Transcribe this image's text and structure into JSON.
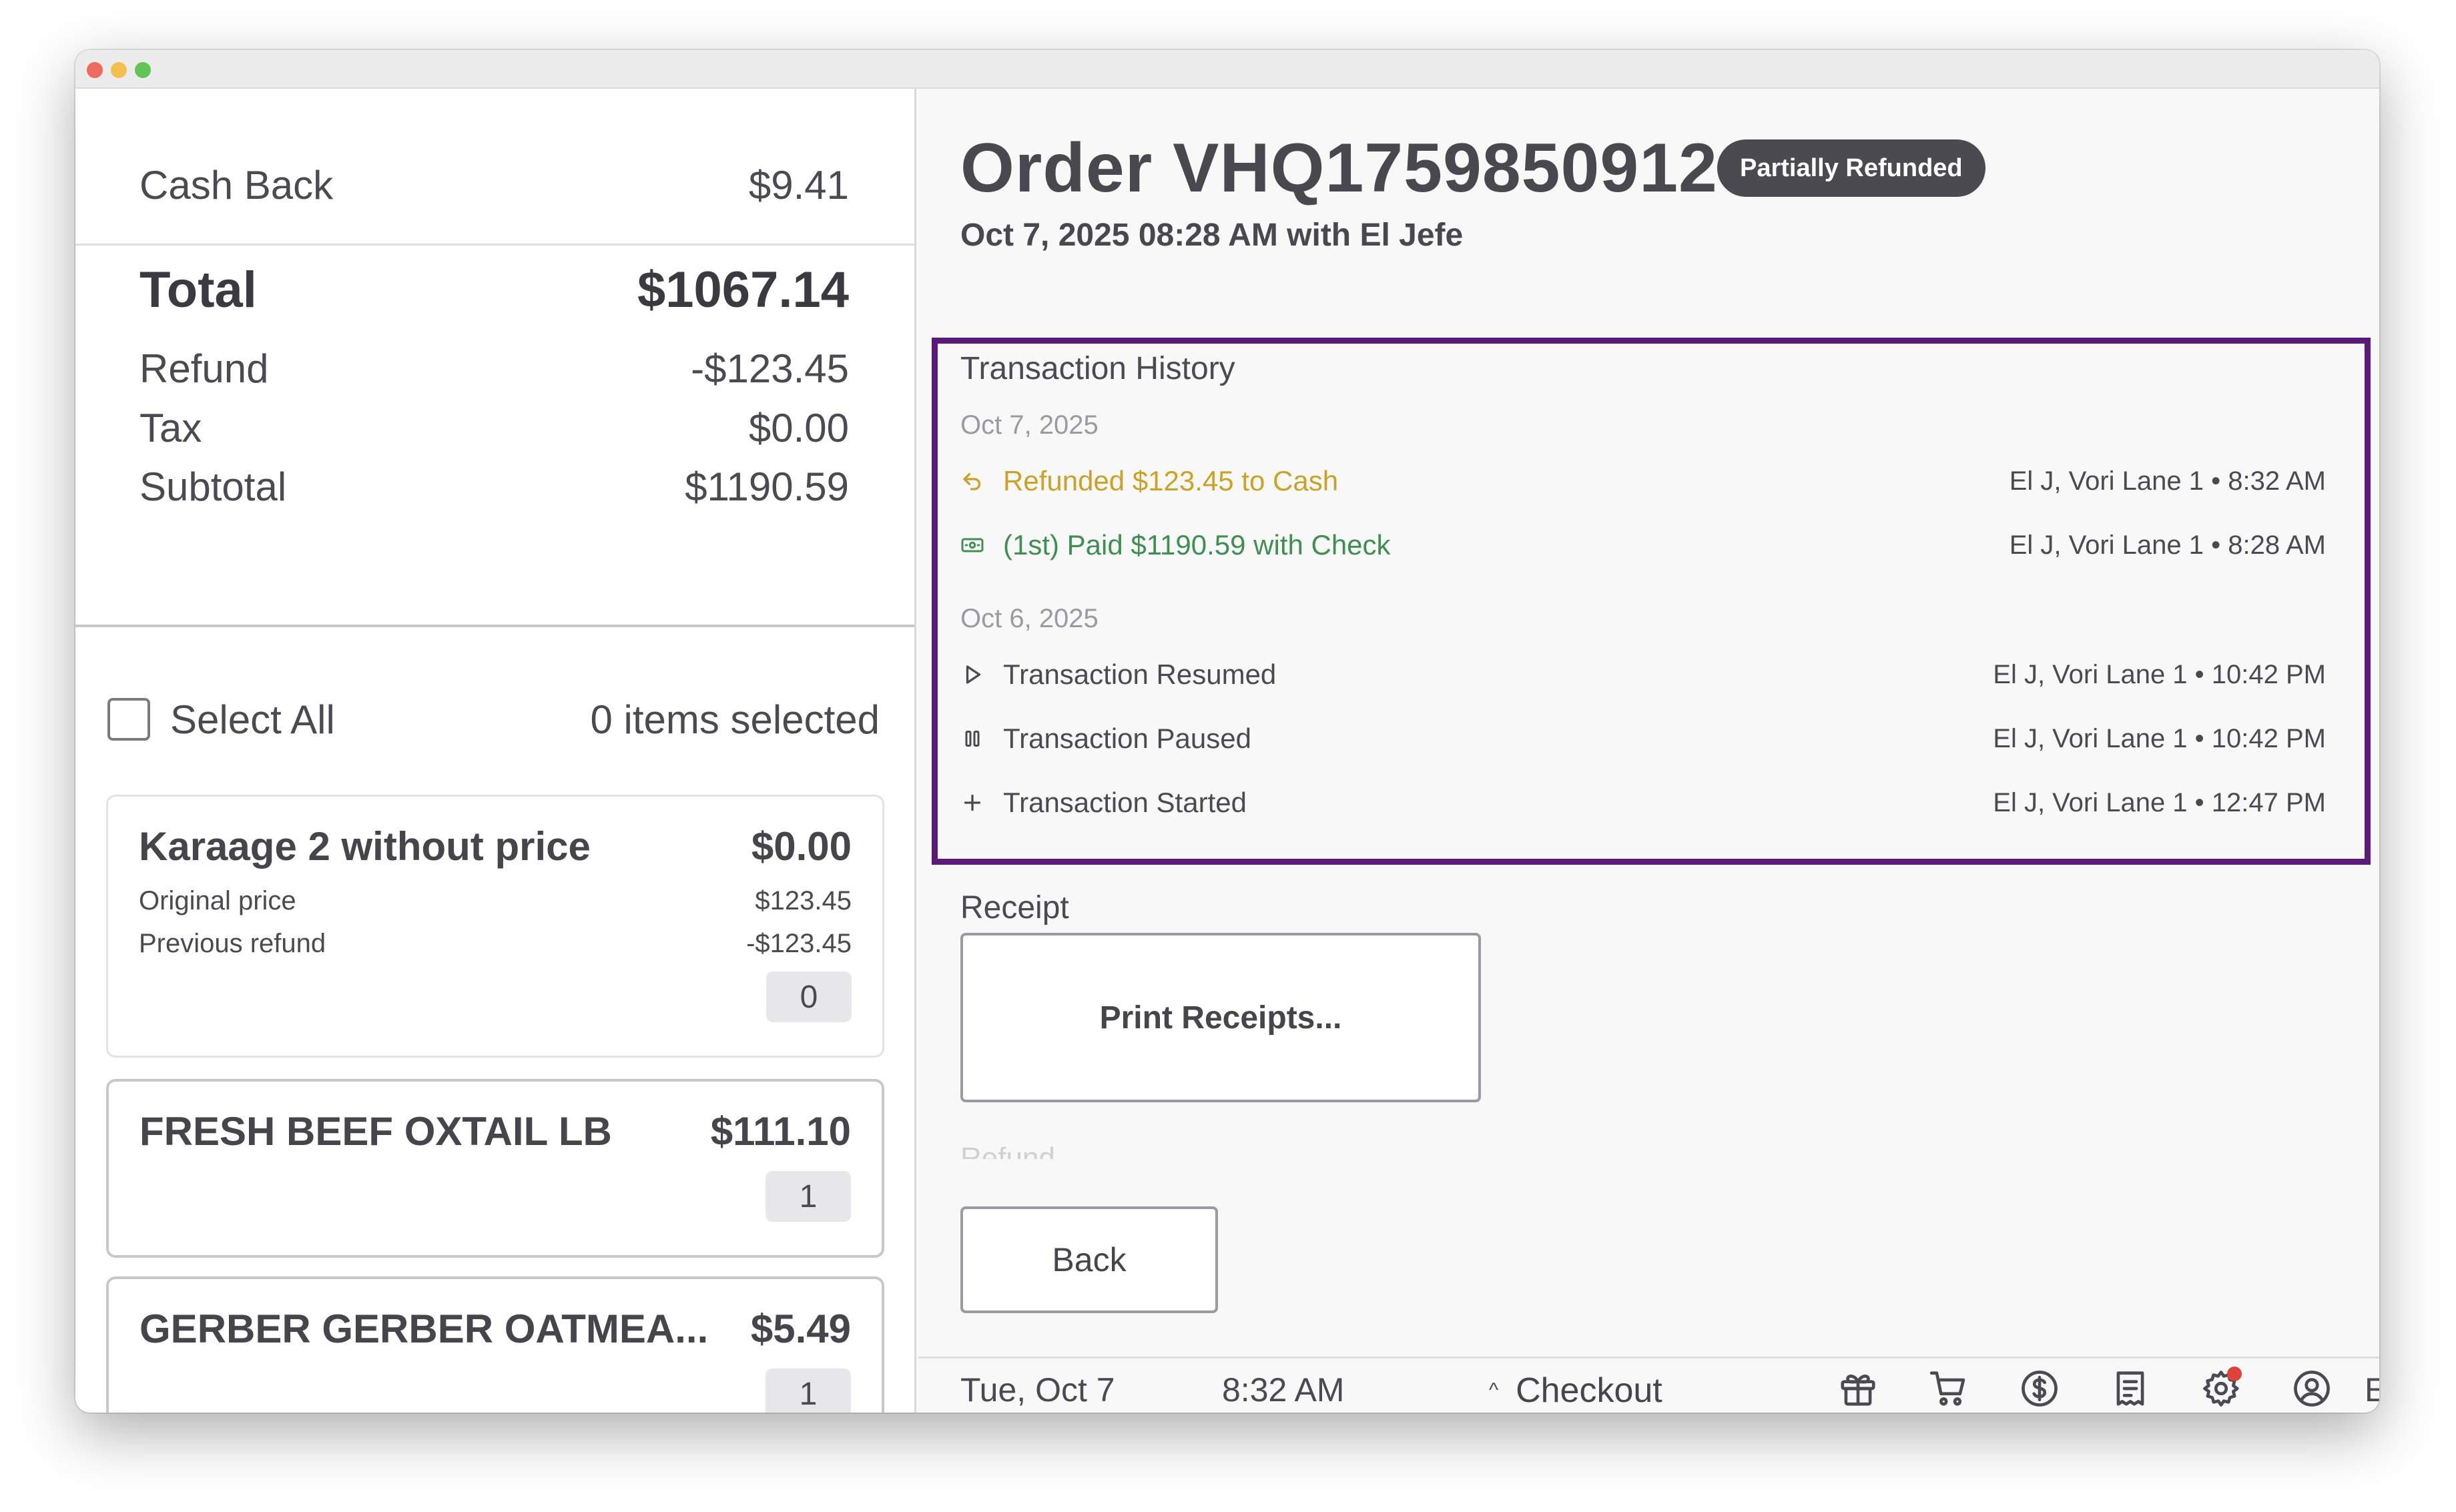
{
  "summary": {
    "cash_back_label": "Cash Back",
    "cash_back_value": "$9.41",
    "total_label": "Total",
    "total_value": "$1067.14",
    "refund_label": "Refund",
    "refund_value": "-$123.45",
    "tax_label": "Tax",
    "tax_value": "$0.00",
    "subtotal_label": "Subtotal",
    "subtotal_value": "$1190.59"
  },
  "selection": {
    "select_all_label": "Select All",
    "selected_count": "0 items selected"
  },
  "items": [
    {
      "name": "Karaage 2 without price",
      "price": "$0.00",
      "original_label": "Original price",
      "original_value": "$123.45",
      "prev_refund_label": "Previous refund",
      "prev_refund_value": "-$123.45",
      "qty": "0"
    },
    {
      "name": "FRESH BEEF OXTAIL LB",
      "price": "$111.10",
      "qty": "1"
    },
    {
      "name": "GERBER GERBER OATMEA...",
      "price": "$5.49",
      "qty": "1"
    }
  ],
  "order": {
    "title": "Order VHQ1759850912",
    "status_badge": "Partially Refunded",
    "subtitle": "Oct 7, 2025 08:28 AM with El Jefe"
  },
  "history": {
    "title": "Transaction History",
    "groups": [
      {
        "date": "Oct 7, 2025",
        "entries": [
          {
            "label": "Refunded $123.45 to Cash",
            "meta": "El J, Vori Lane 1 • 8:32 AM",
            "icon": "refund-arrow-icon",
            "color": "#c9a227"
          },
          {
            "label": "(1st) Paid $1190.59 with Check",
            "meta": "El J, Vori Lane 1 • 8:28 AM",
            "icon": "cash-icon",
            "color": "#3f8f52"
          }
        ]
      },
      {
        "date": "Oct 6, 2025",
        "entries": [
          {
            "label": "Transaction Resumed",
            "meta": "El J, Vori Lane 1 • 10:42 PM",
            "icon": "play-icon"
          },
          {
            "label": "Transaction Paused",
            "meta": "El J, Vori Lane 1 • 10:42 PM",
            "icon": "pause-icon"
          },
          {
            "label": "Transaction Started",
            "meta": "El J, Vori Lane 1 • 12:47 PM",
            "icon": "plus-icon"
          }
        ]
      }
    ]
  },
  "receipt": {
    "title": "Receipt",
    "print_label": "Print Receipts..."
  },
  "refund_section": {
    "title": "Refund"
  },
  "actions": {
    "back_label": "Back"
  },
  "footer": {
    "date": "Tue, Oct 7",
    "time": "8:32 AM",
    "checkout_label": "Checkout",
    "icons": [
      "gift-icon",
      "cart-icon",
      "dollar-icon",
      "receipt-icon",
      "settings-icon",
      "user-icon"
    ],
    "user": "El"
  },
  "colors": {
    "highlight_border": "#5b1a79",
    "refund": "#c9a227",
    "paid": "#3f8f52",
    "badge_bg": "#4a4a50"
  }
}
